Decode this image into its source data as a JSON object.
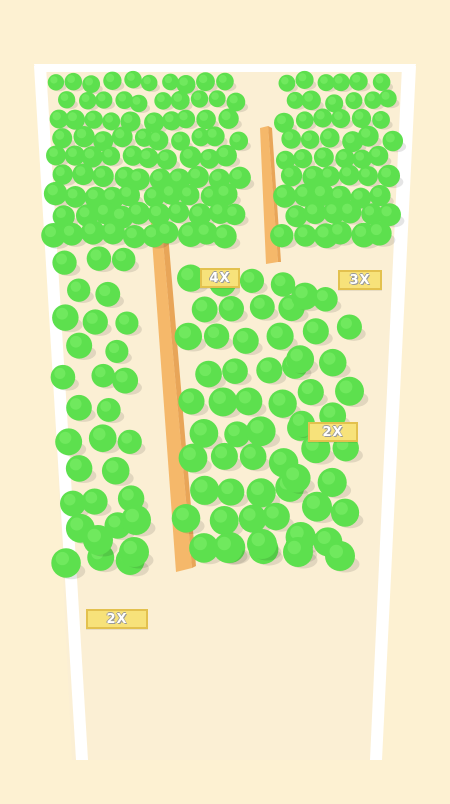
{
  "game": {
    "multipliers": [
      {
        "label": "4X"
      },
      {
        "label": "3X"
      },
      {
        "label": "2X"
      },
      {
        "label": "2X"
      }
    ]
  },
  "colors": {
    "background": "#fdf1d2",
    "track_floor": "#fbeed0",
    "track_border": "#ffffff",
    "divider": "#f7c27a",
    "tree": "#5de04e",
    "tree_highlight": "#7ff06b",
    "badge": "#f7e27a"
  },
  "icons": [
    "tree-icon"
  ]
}
